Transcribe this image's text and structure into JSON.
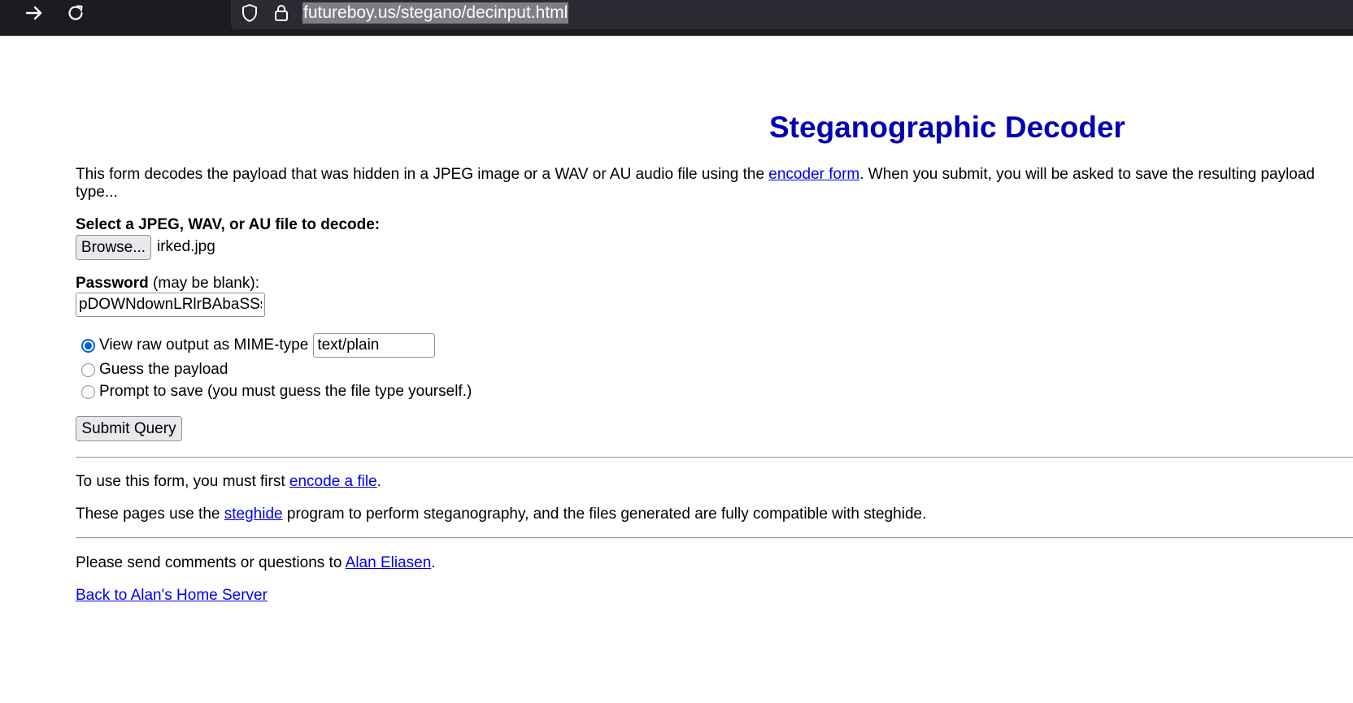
{
  "browser": {
    "url": "futureboy.us/stegano/decinput.html"
  },
  "page": {
    "title": "Steganographic Decoder",
    "intro": {
      "before_link": "This form decodes the payload that was hidden in a JPEG image or a WAV or AU audio file using the ",
      "link": "encoder form",
      "after_link": ". When you submit, you will be asked to save the resulting payload",
      "line2": "type..."
    },
    "file_field": {
      "label": "Select a JPEG, WAV, or AU file to decode:",
      "browse_label": "Browse...",
      "file_name": "irked.jpg"
    },
    "password_field": {
      "label_strong": "Password",
      "label_rest": " (may be blank):",
      "value": "pDOWNdownLRlrBAbaSSss"
    },
    "output_options": [
      {
        "label": "View raw output as MIME-type",
        "checked": true
      },
      {
        "label": "Guess the payload",
        "checked": false
      },
      {
        "label": "Prompt to save (you must guess the file type yourself.)",
        "checked": false
      }
    ],
    "mime_type_value": "text/plain",
    "submit_label": "Submit Query",
    "encode_note": {
      "before_link": "To use this form, you must first ",
      "link": "encode a file",
      "after_link": "."
    },
    "steghide_note": {
      "before_link": "These pages use the ",
      "link": "steghide",
      "after_link": " program to perform steganography, and the files generated are fully compatible with steghide."
    },
    "contact": {
      "before_link": "Please send comments or questions to ",
      "link": "Alan Eliasen",
      "after_link": "."
    },
    "back_link": "Back to Alan's Home Server"
  },
  "colors": {
    "title": "#0000b4",
    "link": "#0000ee",
    "toolbar": "#1c1b22",
    "urlbar": "#2b2a33",
    "radio_accent": "#0060df"
  },
  "icons": {
    "forward": "forward-arrow-icon",
    "reload": "reload-icon",
    "tracking": "shield-icon",
    "security": "lock-icon"
  }
}
